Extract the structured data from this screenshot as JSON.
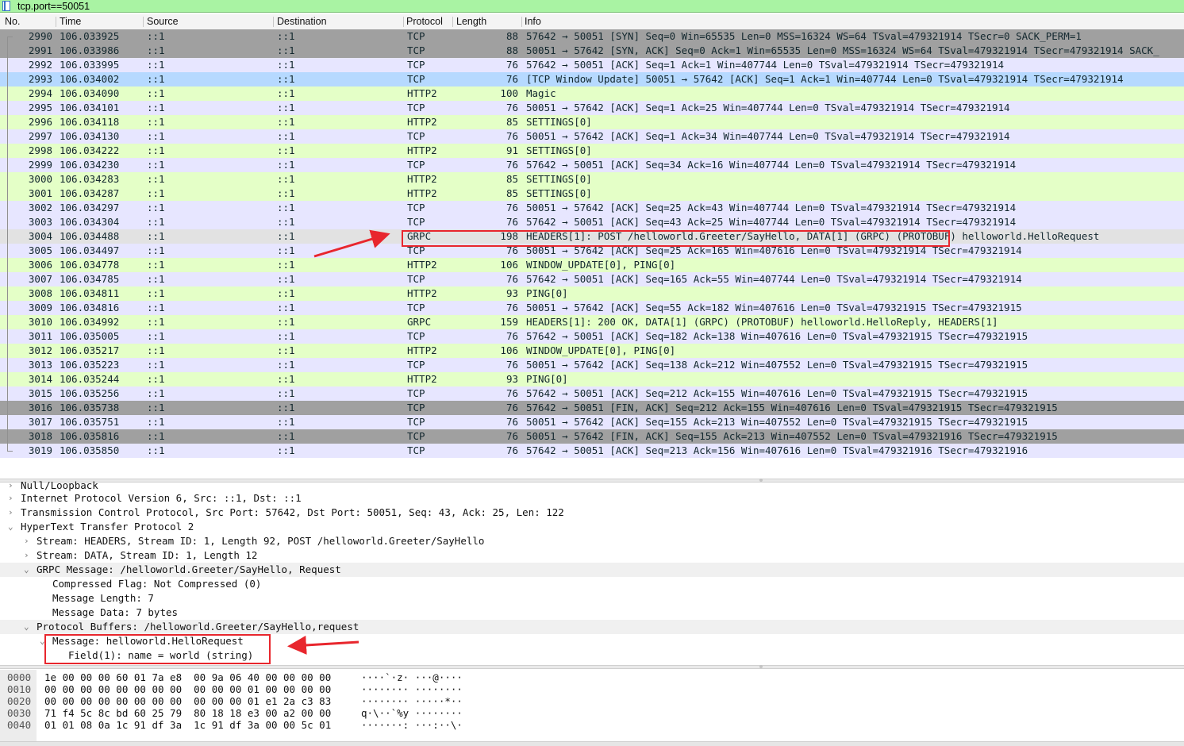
{
  "filter": {
    "value": "tcp.port==50051"
  },
  "columns": {
    "no": "No.",
    "time": "Time",
    "source": "Source",
    "destination": "Destination",
    "protocol": "Protocol",
    "length": "Length",
    "info": "Info"
  },
  "packets": [
    {
      "no": "2990",
      "time": "106.033925",
      "src": "::1",
      "dst": "::1",
      "proto": "TCP",
      "len": "88",
      "info": "57642 → 50051 [SYN] Seq=0 Win=65535 Len=0 MSS=16324 WS=64 TSval=479321914 TSecr=0 SACK_PERM=1",
      "bg": "gray"
    },
    {
      "no": "2991",
      "time": "106.033986",
      "src": "::1",
      "dst": "::1",
      "proto": "TCP",
      "len": "88",
      "info": "50051 → 57642 [SYN, ACK] Seq=0 Ack=1 Win=65535 Len=0 MSS=16324 WS=64 TSval=479321914 TSecr=479321914 SACK_",
      "bg": "gray"
    },
    {
      "no": "2992",
      "time": "106.033995",
      "src": "::1",
      "dst": "::1",
      "proto": "TCP",
      "len": "76",
      "info": "57642 → 50051 [ACK] Seq=1 Ack=1 Win=407744 Len=0 TSval=479321914 TSecr=479321914",
      "bg": "tcp"
    },
    {
      "no": "2993",
      "time": "106.034002",
      "src": "::1",
      "dst": "::1",
      "proto": "TCP",
      "len": "76",
      "info": "[TCP Window Update] 50051 → 57642 [ACK] Seq=1 Ack=1 Win=407744 Len=0 TSval=479321914 TSecr=479321914",
      "bg": "blue"
    },
    {
      "no": "2994",
      "time": "106.034090",
      "src": "::1",
      "dst": "::1",
      "proto": "HTTP2",
      "len": "100",
      "info": "Magic",
      "bg": "http"
    },
    {
      "no": "2995",
      "time": "106.034101",
      "src": "::1",
      "dst": "::1",
      "proto": "TCP",
      "len": "76",
      "info": "50051 → 57642 [ACK] Seq=1 Ack=25 Win=407744 Len=0 TSval=479321914 TSecr=479321914",
      "bg": "tcp"
    },
    {
      "no": "2996",
      "time": "106.034118",
      "src": "::1",
      "dst": "::1",
      "proto": "HTTP2",
      "len": "85",
      "info": "SETTINGS[0]",
      "bg": "http"
    },
    {
      "no": "2997",
      "time": "106.034130",
      "src": "::1",
      "dst": "::1",
      "proto": "TCP",
      "len": "76",
      "info": "50051 → 57642 [ACK] Seq=1 Ack=34 Win=407744 Len=0 TSval=479321914 TSecr=479321914",
      "bg": "tcp"
    },
    {
      "no": "2998",
      "time": "106.034222",
      "src": "::1",
      "dst": "::1",
      "proto": "HTTP2",
      "len": "91",
      "info": "SETTINGS[0]",
      "bg": "http"
    },
    {
      "no": "2999",
      "time": "106.034230",
      "src": "::1",
      "dst": "::1",
      "proto": "TCP",
      "len": "76",
      "info": "57642 → 50051 [ACK] Seq=34 Ack=16 Win=407744 Len=0 TSval=479321914 TSecr=479321914",
      "bg": "tcp"
    },
    {
      "no": "3000",
      "time": "106.034283",
      "src": "::1",
      "dst": "::1",
      "proto": "HTTP2",
      "len": "85",
      "info": "SETTINGS[0]",
      "bg": "http"
    },
    {
      "no": "3001",
      "time": "106.034287",
      "src": "::1",
      "dst": "::1",
      "proto": "HTTP2",
      "len": "85",
      "info": "SETTINGS[0]",
      "bg": "http"
    },
    {
      "no": "3002",
      "time": "106.034297",
      "src": "::1",
      "dst": "::1",
      "proto": "TCP",
      "len": "76",
      "info": "50051 → 57642 [ACK] Seq=25 Ack=43 Win=407744 Len=0 TSval=479321914 TSecr=479321914",
      "bg": "tcp"
    },
    {
      "no": "3003",
      "time": "106.034304",
      "src": "::1",
      "dst": "::1",
      "proto": "TCP",
      "len": "76",
      "info": "57642 → 50051 [ACK] Seq=43 Ack=25 Win=407744 Len=0 TSval=479321914 TSecr=479321914",
      "bg": "tcp"
    },
    {
      "no": "3004",
      "time": "106.034488",
      "src": "::1",
      "dst": "::1",
      "proto": "GRPC",
      "len": "198",
      "info": "HEADERS[1]: POST /helloworld.Greeter/SayHello, DATA[1] (GRPC) (PROTOBUF) helloworld.HelloRequest",
      "bg": "sel"
    },
    {
      "no": "3005",
      "time": "106.034497",
      "src": "::1",
      "dst": "::1",
      "proto": "TCP",
      "len": "76",
      "info": "50051 → 57642 [ACK] Seq=25 Ack=165 Win=407616 Len=0 TSval=479321914 TSecr=479321914",
      "bg": "tcp"
    },
    {
      "no": "3006",
      "time": "106.034778",
      "src": "::1",
      "dst": "::1",
      "proto": "HTTP2",
      "len": "106",
      "info": "WINDOW_UPDATE[0], PING[0]",
      "bg": "http"
    },
    {
      "no": "3007",
      "time": "106.034785",
      "src": "::1",
      "dst": "::1",
      "proto": "TCP",
      "len": "76",
      "info": "57642 → 50051 [ACK] Seq=165 Ack=55 Win=407744 Len=0 TSval=479321914 TSecr=479321914",
      "bg": "tcp"
    },
    {
      "no": "3008",
      "time": "106.034811",
      "src": "::1",
      "dst": "::1",
      "proto": "HTTP2",
      "len": "93",
      "info": "PING[0]",
      "bg": "http"
    },
    {
      "no": "3009",
      "time": "106.034816",
      "src": "::1",
      "dst": "::1",
      "proto": "TCP",
      "len": "76",
      "info": "50051 → 57642 [ACK] Seq=55 Ack=182 Win=407616 Len=0 TSval=479321915 TSecr=479321915",
      "bg": "tcp"
    },
    {
      "no": "3010",
      "time": "106.034992",
      "src": "::1",
      "dst": "::1",
      "proto": "GRPC",
      "len": "159",
      "info": "HEADERS[1]: 200 OK, DATA[1] (GRPC) (PROTOBUF) helloworld.HelloReply, HEADERS[1]",
      "bg": "http"
    },
    {
      "no": "3011",
      "time": "106.035005",
      "src": "::1",
      "dst": "::1",
      "proto": "TCP",
      "len": "76",
      "info": "57642 → 50051 [ACK] Seq=182 Ack=138 Win=407616 Len=0 TSval=479321915 TSecr=479321915",
      "bg": "tcp"
    },
    {
      "no": "3012",
      "time": "106.035217",
      "src": "::1",
      "dst": "::1",
      "proto": "HTTP2",
      "len": "106",
      "info": "WINDOW_UPDATE[0], PING[0]",
      "bg": "http"
    },
    {
      "no": "3013",
      "time": "106.035223",
      "src": "::1",
      "dst": "::1",
      "proto": "TCP",
      "len": "76",
      "info": "50051 → 57642 [ACK] Seq=138 Ack=212 Win=407552 Len=0 TSval=479321915 TSecr=479321915",
      "bg": "tcp"
    },
    {
      "no": "3014",
      "time": "106.035244",
      "src": "::1",
      "dst": "::1",
      "proto": "HTTP2",
      "len": "93",
      "info": "PING[0]",
      "bg": "http"
    },
    {
      "no": "3015",
      "time": "106.035256",
      "src": "::1",
      "dst": "::1",
      "proto": "TCP",
      "len": "76",
      "info": "57642 → 50051 [ACK] Seq=212 Ack=155 Win=407616 Len=0 TSval=479321915 TSecr=479321915",
      "bg": "tcp"
    },
    {
      "no": "3016",
      "time": "106.035738",
      "src": "::1",
      "dst": "::1",
      "proto": "TCP",
      "len": "76",
      "info": "57642 → 50051 [FIN, ACK] Seq=212 Ack=155 Win=407616 Len=0 TSval=479321915 TSecr=479321915",
      "bg": "gray"
    },
    {
      "no": "3017",
      "time": "106.035751",
      "src": "::1",
      "dst": "::1",
      "proto": "TCP",
      "len": "76",
      "info": "50051 → 57642 [ACK] Seq=155 Ack=213 Win=407552 Len=0 TSval=479321915 TSecr=479321915",
      "bg": "tcp"
    },
    {
      "no": "3018",
      "time": "106.035816",
      "src": "::1",
      "dst": "::1",
      "proto": "TCP",
      "len": "76",
      "info": "50051 → 57642 [FIN, ACK] Seq=155 Ack=213 Win=407552 Len=0 TSval=479321916 TSecr=479321915",
      "bg": "gray"
    },
    {
      "no": "3019",
      "time": "106.035850",
      "src": "::1",
      "dst": "::1",
      "proto": "TCP",
      "len": "76",
      "info": "57642 → 50051 [ACK] Seq=213 Ack=156 Win=407616 Len=0 TSval=479321916 TSecr=479321916",
      "bg": "tcp"
    }
  ],
  "details": [
    {
      "text": "Null/Loopback",
      "level": 0,
      "expander": "collapsed",
      "highlight": false
    },
    {
      "text": "Internet Protocol Version 6, Src: ::1, Dst: ::1",
      "level": 0,
      "expander": "collapsed",
      "highlight": false
    },
    {
      "text": "Transmission Control Protocol, Src Port: 57642, Dst Port: 50051, Seq: 43, Ack: 25, Len: 122",
      "level": 0,
      "expander": "collapsed",
      "highlight": false
    },
    {
      "text": "HyperText Transfer Protocol 2",
      "level": 0,
      "expander": "expanded",
      "highlight": false
    },
    {
      "text": "Stream: HEADERS, Stream ID: 1, Length 92, POST /helloworld.Greeter/SayHello",
      "level": 1,
      "expander": "collapsed",
      "highlight": false
    },
    {
      "text": "Stream: DATA, Stream ID: 1, Length 12",
      "level": 1,
      "expander": "collapsed",
      "highlight": false
    },
    {
      "text": "GRPC Message: /helloworld.Greeter/SayHello, Request",
      "level": 1,
      "expander": "expanded",
      "highlight": true
    },
    {
      "text": "Compressed Flag: Not Compressed (0)",
      "level": 2,
      "expander": "none",
      "highlight": false
    },
    {
      "text": "Message Length: 7",
      "level": 2,
      "expander": "none",
      "highlight": false
    },
    {
      "text": "Message Data: 7 bytes",
      "level": 2,
      "expander": "none",
      "highlight": false
    },
    {
      "text": "Protocol Buffers: /helloworld.Greeter/SayHello,request",
      "level": 1,
      "expander": "expanded",
      "highlight": true
    },
    {
      "text": "Message: helloworld.HelloRequest",
      "level": 2,
      "expander": "expanded",
      "highlight": false
    },
    {
      "text": "Field(1): name = world (string)",
      "level": 3,
      "expander": "none",
      "highlight": false
    }
  ],
  "bytes": [
    {
      "offset": "0000",
      "hex": "1e 00 00 00 60 01 7a e8  00 9a 06 40 00 00 00 00",
      "ascii": "····`·z· ···@····"
    },
    {
      "offset": "0010",
      "hex": "00 00 00 00 00 00 00 00  00 00 00 01 00 00 00 00",
      "ascii": "········ ········"
    },
    {
      "offset": "0020",
      "hex": "00 00 00 00 00 00 00 00  00 00 00 01 e1 2a c3 83",
      "ascii": "········ ·····*··"
    },
    {
      "offset": "0030",
      "hex": "71 f4 5c 8c bd 60 25 79  80 18 18 e3 00 a2 00 00",
      "ascii": "q·\\··`%y ········"
    },
    {
      "offset": "0040",
      "hex": "01 01 08 0a 1c 91 df 3a  1c 91 df 3a 00 00 5c 01",
      "ascii": "·······: ···:··\\·"
    }
  ],
  "colors": {
    "filter_bg": "#a9f3a3",
    "tcp_row": "#e7e6ff",
    "http_row": "#e4ffc7",
    "gray_row": "#a0a0a0",
    "window_update_row": "#b6d9ff",
    "annotation": "#e8262d"
  }
}
